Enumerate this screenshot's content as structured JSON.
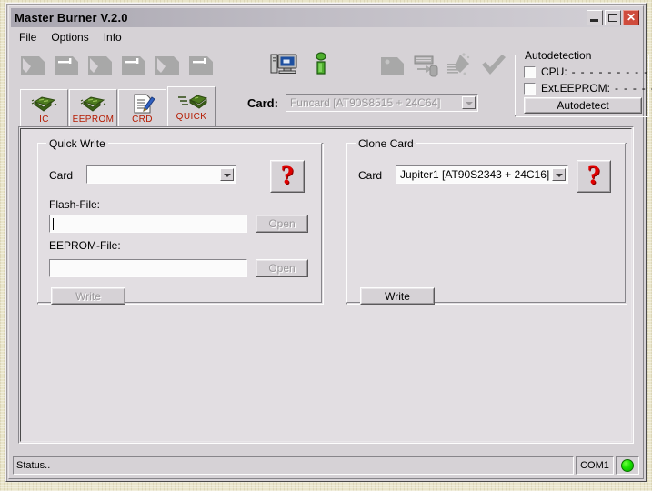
{
  "window": {
    "title": "Master Burner V.2.0",
    "buttons": {
      "minimize": "minimize-button",
      "maximize": "maximize-button",
      "close": "✕"
    }
  },
  "menu": {
    "items": [
      {
        "label": "File"
      },
      {
        "label": "Options"
      },
      {
        "label": "Info"
      }
    ]
  },
  "toolbar": {
    "icons": [
      {
        "name": "card-read-icon",
        "enabled": false
      },
      {
        "name": "card-write-icon",
        "enabled": false
      },
      {
        "name": "card-read2-icon",
        "enabled": false
      },
      {
        "name": "card-write2-icon",
        "enabled": false
      },
      {
        "name": "card-read3-icon",
        "enabled": false
      },
      {
        "name": "card-write3-icon",
        "enabled": false
      },
      {
        "name": "computer-icon",
        "enabled": true
      },
      {
        "name": "info-icon",
        "enabled": true
      },
      {
        "name": "card-blank-icon",
        "enabled": false
      },
      {
        "name": "card-to-disk-icon",
        "enabled": false
      },
      {
        "name": "erase-card-icon",
        "enabled": false
      },
      {
        "name": "verify-check-icon",
        "enabled": false
      }
    ]
  },
  "card_selector": {
    "label": "Card:",
    "value": "Funcard [AT90S8515 + 24C64]",
    "disabled": true
  },
  "autodetection": {
    "title": "Autodetection",
    "cpu": {
      "label": "CPU:",
      "checked": false,
      "value": "- - - - - - - - - - - - -"
    },
    "ext_eeprom": {
      "label": "Ext.EEPROM:",
      "checked": false,
      "value": "- - - - - - -"
    },
    "button": "Autodetect"
  },
  "tabs": [
    {
      "label": "IC",
      "icon": "chip-icon",
      "active": false
    },
    {
      "label": "EEPROM",
      "icon": "chip-icon",
      "active": false
    },
    {
      "label": "CRD",
      "icon": "document-pen-icon",
      "active": false
    },
    {
      "label": "QUICK",
      "icon": "fast-card-icon",
      "active": true
    }
  ],
  "quick_write": {
    "title": "Quick Write",
    "card_label": "Card",
    "card_value": "",
    "help_glyph": "?",
    "flash_label": "Flash-File:",
    "flash_value": "",
    "flash_open": "Open",
    "eeprom_label": "EEPROM-File:",
    "eeprom_value": "",
    "eeprom_open": "Open",
    "write_button": "Write"
  },
  "clone_card": {
    "title": "Clone Card",
    "card_label": "Card",
    "card_value": "Jupiter1 [AT90S2343 + 24C16]",
    "help_glyph": "?",
    "write_button": "Write"
  },
  "statusbar": {
    "status": "Status..",
    "port": "COM1",
    "led": "green-led"
  },
  "colors": {
    "accent_red": "#b51a00",
    "help_red": "#e00000",
    "led_green": "#18e000",
    "panel_bg": "#e2dee2",
    "window_bg": "#d6d2d6",
    "desktop": "#e9e5ca"
  }
}
